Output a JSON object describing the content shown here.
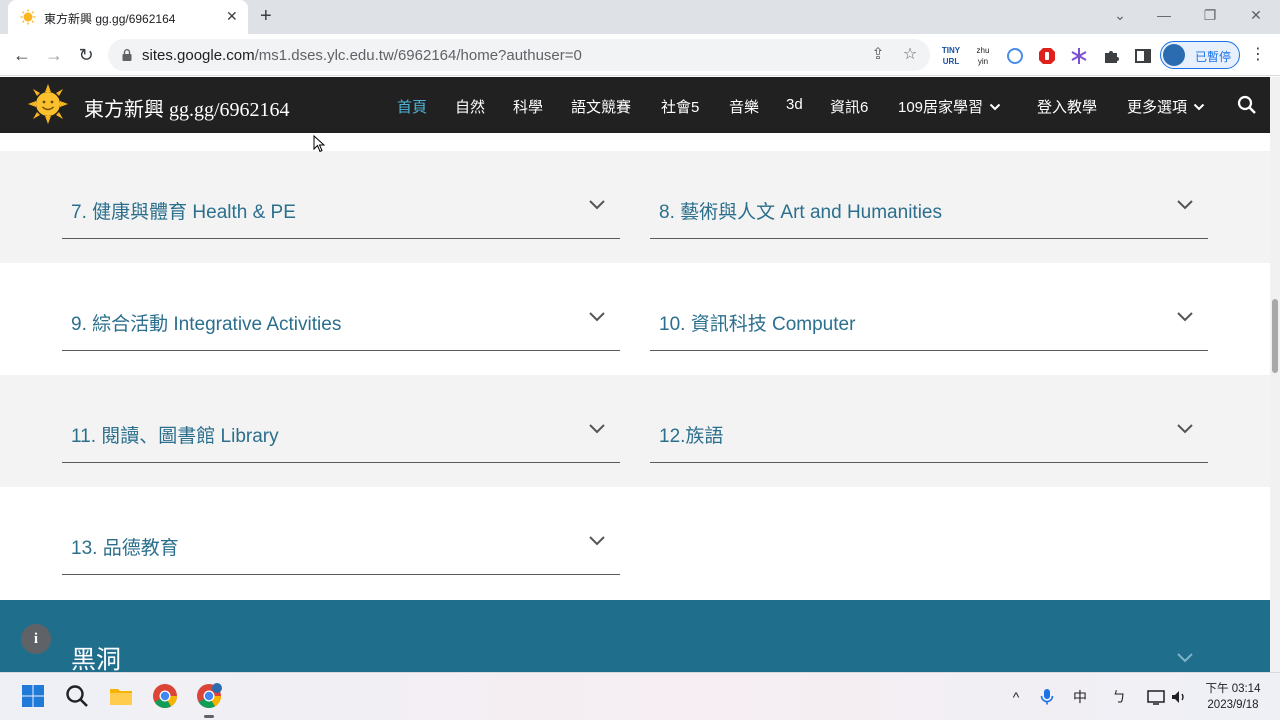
{
  "browser": {
    "tab_title": "東方新興 gg.gg/6962164",
    "tab_close": "✕",
    "new_tab": "+",
    "url_host": "sites.google.com",
    "url_path": "/ms1.dses.ylc.edu.tw/6962164/home?authuser=0",
    "profile_label": "已暫停",
    "extensions": [
      "TINY URL",
      "zhu yin"
    ]
  },
  "site": {
    "title": "東方新興 gg.gg/6962164",
    "nav": [
      {
        "label": "首頁",
        "active": true
      },
      {
        "label": "自然"
      },
      {
        "label": "科學"
      },
      {
        "label": "語文競賽"
      },
      {
        "label": "社會5"
      },
      {
        "label": "音樂"
      },
      {
        "label": "3d"
      },
      {
        "label": "資訊6"
      },
      {
        "label": "109居家學習",
        "has_menu": true
      },
      {
        "label": "登入教學"
      },
      {
        "label": "更多選項",
        "has_menu": true
      }
    ]
  },
  "sections": [
    {
      "label": "7. 健康與體育 Health & PE"
    },
    {
      "label": "8. 藝術與人文 Art and Humanities"
    },
    {
      "label": "9. 綜合活動 Integrative Activities"
    },
    {
      "label": "10. 資訊科技 Computer"
    },
    {
      "label": "11. 閱讀、圖書館 Library"
    },
    {
      "label": "12.族語"
    },
    {
      "label": "13. 品德教育"
    }
  ],
  "footer": {
    "title": "黑洞",
    "info_icon": "i"
  },
  "taskbar": {
    "ime": "中",
    "clock_ampm_time": "下午 03:14",
    "clock_date": "2023/9/18"
  },
  "colors": {
    "header_bg": "#212121",
    "nav_active": "#4fb3d9",
    "section_label": "#2b6f8d",
    "footer_bg": "#1f6e8c"
  }
}
